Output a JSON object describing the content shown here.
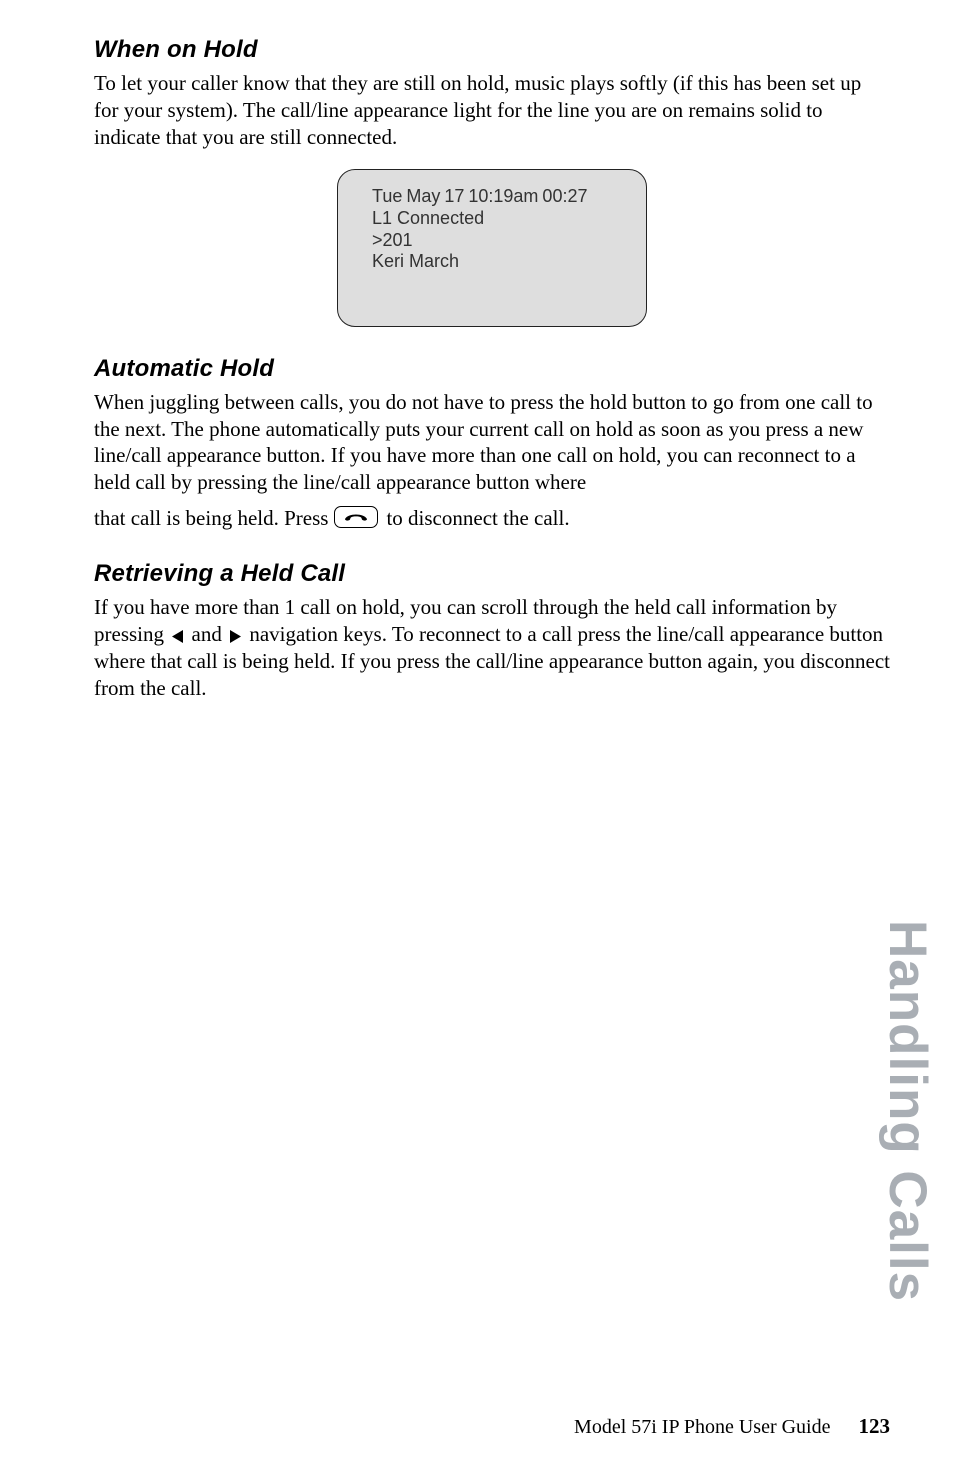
{
  "sections": {
    "when_on_hold": {
      "title": "When on Hold",
      "para": "To let your caller know that they are still on hold, music plays softly (if this has been set up for your system). The call/line appearance light for the line you are on remains solid to indicate that you are still connected."
    },
    "automatic_hold": {
      "title": "Automatic Hold",
      "para": "When juggling between calls, you do not have to press the hold button to go from one call to the next. The phone automatically puts your current call on hold as soon as you press a new line/call appearance button. If you have more than one call on hold, you can reconnect to a held call by pressing the line/call appearance button where",
      "press_pre": "that call is being held. Press",
      "press_post": "to disconnect the call."
    },
    "retrieve": {
      "title": "Retrieving a Held Call",
      "para_pre": "If you have more than 1 call on hold, you can scroll through the held call information by pressing",
      "and": "and",
      "para_post": "navigation keys. To reconnect to a call press the line/call appearance button where that call is being held. If you press the call/line appearance button again, you disconnect from the call."
    }
  },
  "lcd": {
    "line1": "Tue May 17 10:19am   00:27",
    "line2": "L1 Connected",
    "line3": ">201",
    "line4": "Keri March"
  },
  "side_tab": "Handling Calls",
  "footer": {
    "guide": "Model 57i IP Phone User Guide",
    "page": "123"
  }
}
